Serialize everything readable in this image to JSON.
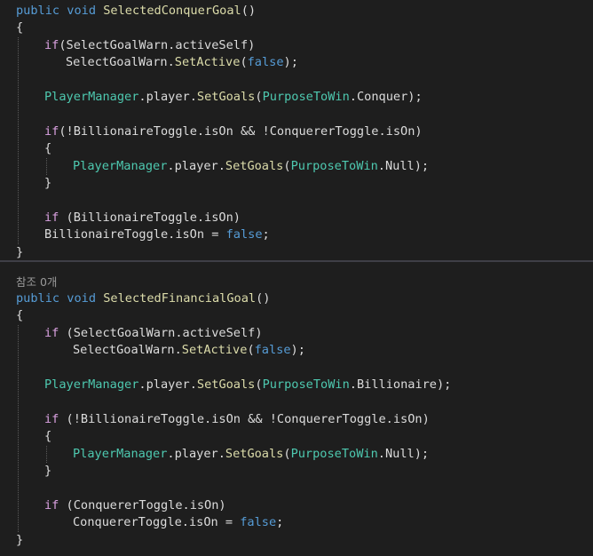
{
  "colors": {
    "background": "#1e1e1e",
    "keyword": "#569cd6",
    "control": "#d8a0df",
    "type": "#4ec9b0",
    "method": "#dcdcaa",
    "plain": "#dcdcdc",
    "codelens": "#999999",
    "separator": "#3f3f46"
  },
  "methods": [
    {
      "codelens": "",
      "lines": [
        {
          "indent": 0,
          "tokens": [
            {
              "t": "public ",
              "c": "kw"
            },
            {
              "t": "void ",
              "c": "kw"
            },
            {
              "t": "SelectedConquerGoal",
              "c": "meth"
            },
            {
              "t": "()",
              "c": "plain"
            }
          ]
        },
        {
          "indent": 0,
          "tokens": [
            {
              "t": "{",
              "c": "plain"
            }
          ]
        },
        {
          "indent": 1,
          "tokens": [
            {
              "t": "if",
              "c": "ctl"
            },
            {
              "t": "(SelectGoalWarn.activeSelf)",
              "c": "plain"
            }
          ]
        },
        {
          "indent": 1.75,
          "tokens": [
            {
              "t": "SelectGoalWarn.",
              "c": "plain"
            },
            {
              "t": "SetActive",
              "c": "meth"
            },
            {
              "t": "(",
              "c": "plain"
            },
            {
              "t": "false",
              "c": "kw"
            },
            {
              "t": ");",
              "c": "plain"
            }
          ]
        },
        {
          "indent": 0,
          "tokens": []
        },
        {
          "indent": 1,
          "tokens": [
            {
              "t": "PlayerManager",
              "c": "type"
            },
            {
              "t": ".player.",
              "c": "plain"
            },
            {
              "t": "SetGoals",
              "c": "meth"
            },
            {
              "t": "(",
              "c": "plain"
            },
            {
              "t": "PurposeToWin",
              "c": "type"
            },
            {
              "t": ".Conquer);",
              "c": "plain"
            }
          ]
        },
        {
          "indent": 0,
          "tokens": []
        },
        {
          "indent": 1,
          "tokens": [
            {
              "t": "if",
              "c": "ctl"
            },
            {
              "t": "(!BillionaireToggle.isOn && !ConquererToggle.isOn)",
              "c": "plain"
            }
          ]
        },
        {
          "indent": 1,
          "tokens": [
            {
              "t": "{",
              "c": "plain"
            }
          ]
        },
        {
          "indent": 2,
          "tokens": [
            {
              "t": "PlayerManager",
              "c": "type"
            },
            {
              "t": ".player.",
              "c": "plain"
            },
            {
              "t": "SetGoals",
              "c": "meth"
            },
            {
              "t": "(",
              "c": "plain"
            },
            {
              "t": "PurposeToWin",
              "c": "type"
            },
            {
              "t": ".Null);",
              "c": "plain"
            }
          ]
        },
        {
          "indent": 1,
          "tokens": [
            {
              "t": "}",
              "c": "plain"
            }
          ]
        },
        {
          "indent": 0,
          "tokens": []
        },
        {
          "indent": 1,
          "tokens": [
            {
              "t": "if",
              "c": "ctl"
            },
            {
              "t": " (BillionaireToggle.isOn)",
              "c": "plain"
            }
          ]
        },
        {
          "indent": 1,
          "tokens": [
            {
              "t": "BillionaireToggle.isOn = ",
              "c": "plain"
            },
            {
              "t": "false",
              "c": "kw"
            },
            {
              "t": ";",
              "c": "plain"
            }
          ]
        },
        {
          "indent": 0,
          "tokens": [
            {
              "t": "}",
              "c": "plain"
            }
          ]
        }
      ]
    },
    {
      "codelens": "참조 0개",
      "lines": [
        {
          "indent": 0,
          "tokens": [
            {
              "t": "public ",
              "c": "kw"
            },
            {
              "t": "void ",
              "c": "kw"
            },
            {
              "t": "SelectedFinancialGoal",
              "c": "meth"
            },
            {
              "t": "()",
              "c": "plain"
            }
          ]
        },
        {
          "indent": 0,
          "tokens": [
            {
              "t": "{",
              "c": "plain"
            }
          ]
        },
        {
          "indent": 1,
          "tokens": [
            {
              "t": "if",
              "c": "ctl"
            },
            {
              "t": " (SelectGoalWarn.activeSelf)",
              "c": "plain"
            }
          ]
        },
        {
          "indent": 2,
          "tokens": [
            {
              "t": "SelectGoalWarn.",
              "c": "plain"
            },
            {
              "t": "SetActive",
              "c": "meth"
            },
            {
              "t": "(",
              "c": "plain"
            },
            {
              "t": "false",
              "c": "kw"
            },
            {
              "t": ");",
              "c": "plain"
            }
          ]
        },
        {
          "indent": 0,
          "tokens": []
        },
        {
          "indent": 1,
          "tokens": [
            {
              "t": "PlayerManager",
              "c": "type"
            },
            {
              "t": ".player.",
              "c": "plain"
            },
            {
              "t": "SetGoals",
              "c": "meth"
            },
            {
              "t": "(",
              "c": "plain"
            },
            {
              "t": "PurposeToWin",
              "c": "type"
            },
            {
              "t": ".Billionaire);",
              "c": "plain"
            }
          ]
        },
        {
          "indent": 0,
          "tokens": []
        },
        {
          "indent": 1,
          "tokens": [
            {
              "t": "if",
              "c": "ctl"
            },
            {
              "t": " (!BillionaireToggle.isOn && !ConquererToggle.isOn)",
              "c": "plain"
            }
          ]
        },
        {
          "indent": 1,
          "tokens": [
            {
              "t": "{",
              "c": "plain"
            }
          ]
        },
        {
          "indent": 2,
          "tokens": [
            {
              "t": "PlayerManager",
              "c": "type"
            },
            {
              "t": ".player.",
              "c": "plain"
            },
            {
              "t": "SetGoals",
              "c": "meth"
            },
            {
              "t": "(",
              "c": "plain"
            },
            {
              "t": "PurposeToWin",
              "c": "type"
            },
            {
              "t": ".Null);",
              "c": "plain"
            }
          ]
        },
        {
          "indent": 1,
          "tokens": [
            {
              "t": "}",
              "c": "plain"
            }
          ]
        },
        {
          "indent": 0,
          "tokens": []
        },
        {
          "indent": 1,
          "tokens": [
            {
              "t": "if",
              "c": "ctl"
            },
            {
              "t": " (ConquererToggle.isOn)",
              "c": "plain"
            }
          ]
        },
        {
          "indent": 2,
          "tokens": [
            {
              "t": "ConquererToggle.isOn = ",
              "c": "plain"
            },
            {
              "t": "false",
              "c": "kw"
            },
            {
              "t": ";",
              "c": "plain"
            }
          ]
        },
        {
          "indent": 0,
          "tokens": [
            {
              "t": "}",
              "c": "plain"
            }
          ]
        }
      ]
    }
  ]
}
